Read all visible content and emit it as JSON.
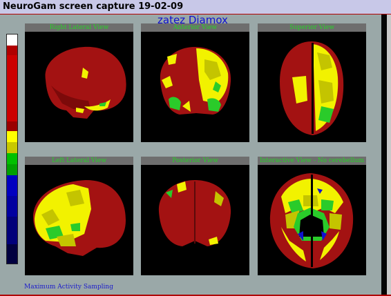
{
  "window": {
    "title": "NeuroGam screen capture 19-02-09"
  },
  "subject": "zatez Diamox",
  "color_scale": [
    "#ffffff",
    "#b00000",
    "#cc0000",
    "#9a0000",
    "#ffff00",
    "#c8c800",
    "#00c000",
    "#00a000",
    "#0000c0",
    "#0000a0",
    "#00007a",
    "#000040"
  ],
  "views": [
    {
      "label": "Right Lateral View"
    },
    {
      "label": "Anterior View"
    },
    {
      "label": "Superior View"
    },
    {
      "label": "Left Lateral View"
    },
    {
      "label": "Posterior View"
    },
    {
      "label": "Interactive View - No cerebellum"
    }
  ],
  "footer": {
    "label": "Maximum Activity Sampling"
  },
  "colors": {
    "red": "#a31212",
    "dark_red": "#7c0a0a",
    "yellow": "#f2f200",
    "olive": "#c4c400",
    "green": "#2acb2a",
    "blue": "#1010d0"
  }
}
